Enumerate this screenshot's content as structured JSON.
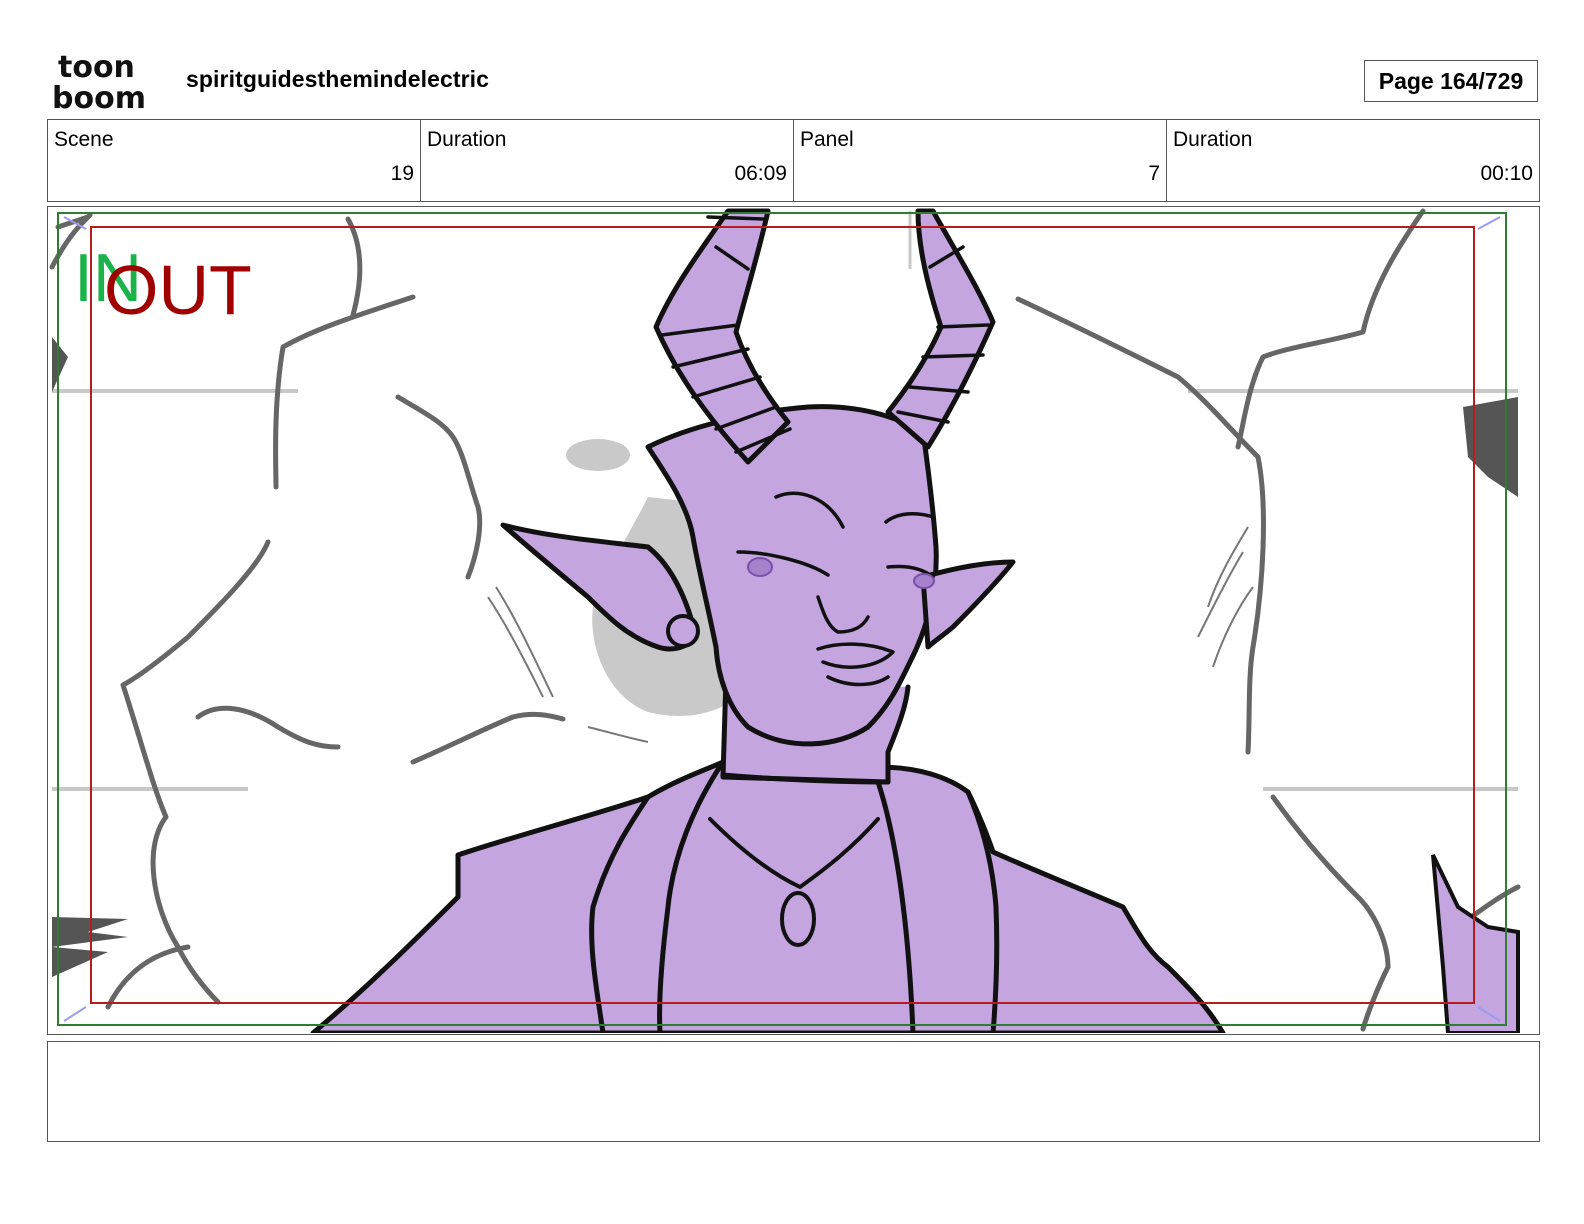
{
  "header": {
    "logo_top": "toon",
    "logo_bottom": "boom",
    "project_title": "spiritguidesthemindelectric",
    "page_label": "Page 164/729"
  },
  "info": {
    "scene_label": "Scene",
    "scene_value": "19",
    "scene_duration_label": "Duration",
    "scene_duration_value": "06:09",
    "panel_label": "Panel",
    "panel_value": "7",
    "panel_duration_label": "Duration",
    "panel_duration_value": "00:10"
  },
  "panel": {
    "in_marker": "IN",
    "out_marker": "OUT",
    "colors": {
      "character_fill": "#c4a5e0",
      "line": "#111111",
      "sketch": "#666666",
      "in_frame": "#2e7d32",
      "out_frame": "#b71c1c",
      "in_text": "#19b34a",
      "out_text": "#a00000"
    }
  },
  "notes": {
    "text": ""
  }
}
